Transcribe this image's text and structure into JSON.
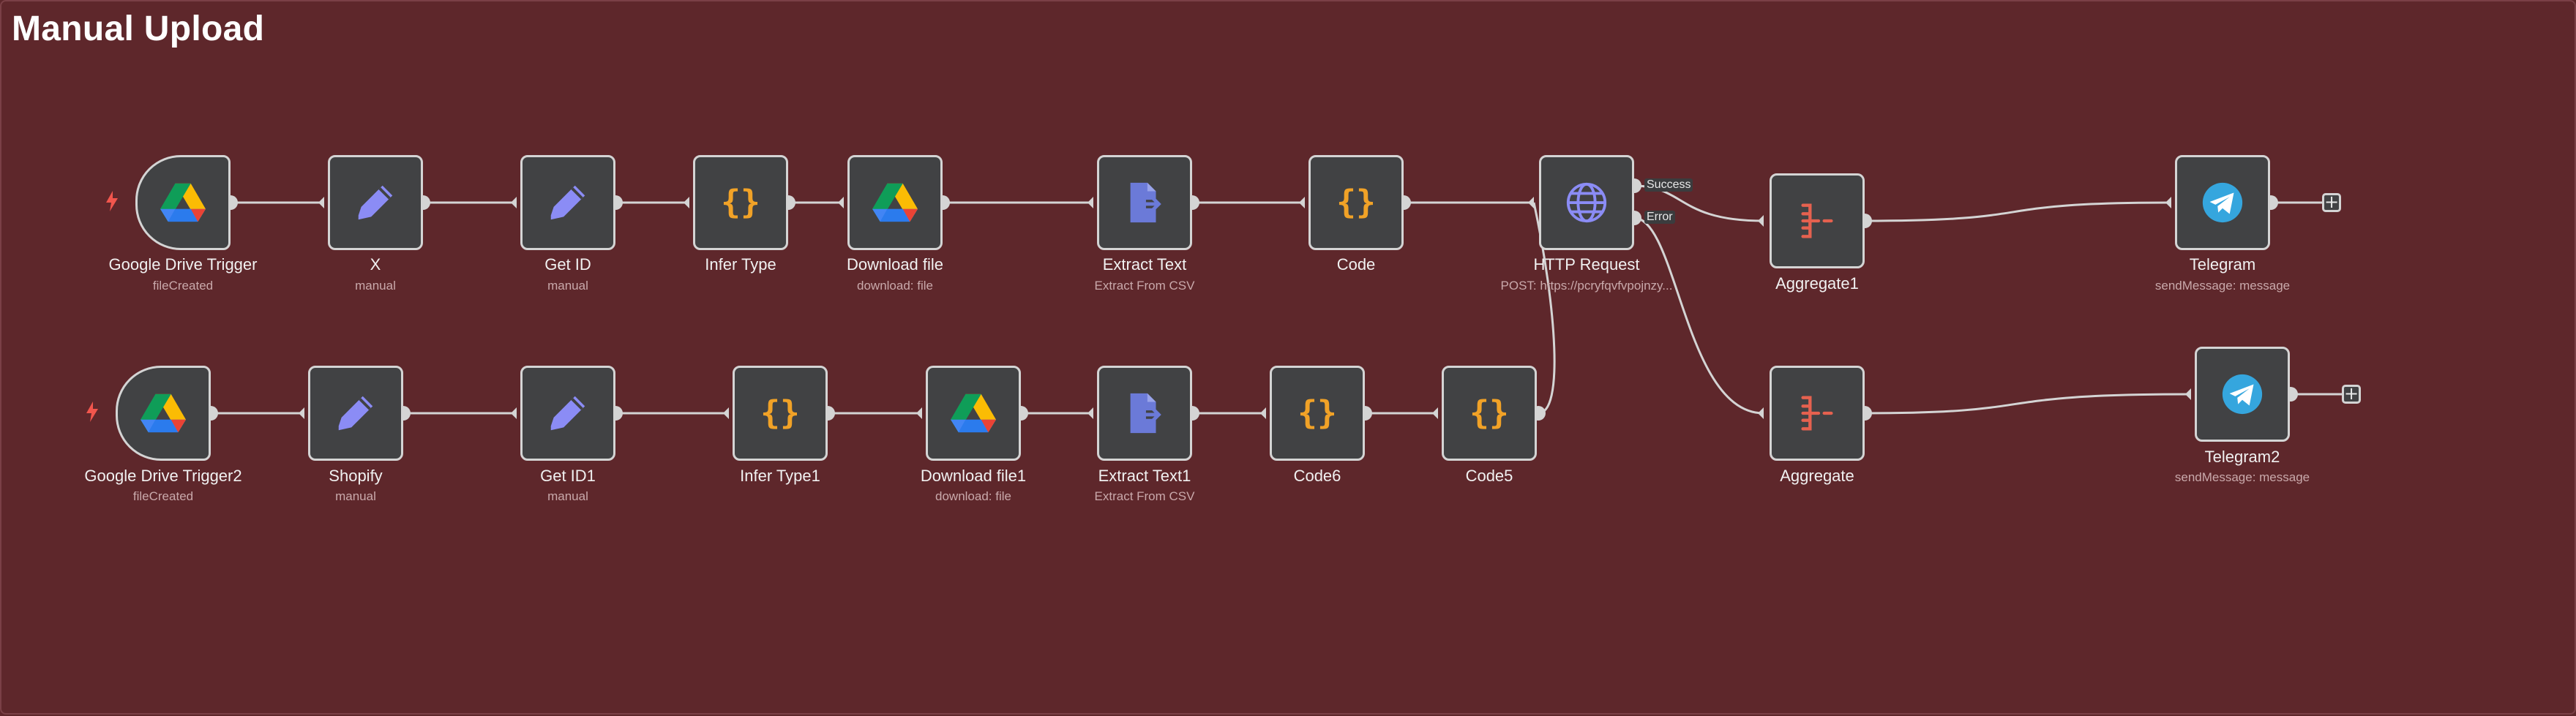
{
  "canvas": {
    "title": "Manual Upload"
  },
  "colors": {
    "background": "#5e272b",
    "node": "#414244",
    "edge": "#d4d4d4",
    "port_labels": "#3b3c3e"
  },
  "nodes": {
    "gdt1": {
      "label": "Google Drive Trigger",
      "sub": "fileCreated",
      "icon": "google-drive-icon"
    },
    "x": {
      "label": "X",
      "sub": "manual",
      "icon": "pencil-icon"
    },
    "getid": {
      "label": "Get ID",
      "sub": "manual",
      "icon": "pencil-icon"
    },
    "infertype": {
      "label": "Infer Type",
      "sub": "",
      "icon": "code-braces-icon"
    },
    "download": {
      "label": "Download file",
      "sub": "download: file",
      "icon": "google-drive-icon"
    },
    "extract": {
      "label": "Extract Text",
      "sub": "Extract From CSV",
      "icon": "file-export-icon"
    },
    "code": {
      "label": "Code",
      "sub": "",
      "icon": "code-braces-icon"
    },
    "http": {
      "label": "HTTP Request",
      "sub": "POST: https://pcryfqvfvpojnzy...",
      "icon": "globe-icon",
      "success_label": "Success",
      "error_label": "Error"
    },
    "agg1": {
      "label": "Aggregate1",
      "sub": "",
      "icon": "aggregate-icon"
    },
    "telegram": {
      "label": "Telegram",
      "sub": "sendMessage: message",
      "icon": "telegram-icon"
    },
    "gdt2": {
      "label": "Google Drive Trigger2",
      "sub": "fileCreated",
      "icon": "google-drive-icon"
    },
    "shopify": {
      "label": "Shopify",
      "sub": "manual",
      "icon": "pencil-icon"
    },
    "getid1": {
      "label": "Get ID1",
      "sub": "manual",
      "icon": "pencil-icon"
    },
    "infertype1": {
      "label": "Infer Type1",
      "sub": "",
      "icon": "code-braces-icon"
    },
    "download1": {
      "label": "Download file1",
      "sub": "download: file",
      "icon": "google-drive-icon"
    },
    "extract1": {
      "label": "Extract Text1",
      "sub": "Extract From CSV",
      "icon": "file-export-icon"
    },
    "code6": {
      "label": "Code6",
      "sub": "",
      "icon": "code-braces-icon"
    },
    "code5": {
      "label": "Code5",
      "sub": "",
      "icon": "code-braces-icon"
    },
    "agg": {
      "label": "Aggregate",
      "sub": "",
      "icon": "aggregate-icon"
    },
    "telegram2": {
      "label": "Telegram2",
      "sub": "sendMessage: message",
      "icon": "telegram-icon"
    }
  },
  "add_buttons": {
    "symbol": "+"
  }
}
